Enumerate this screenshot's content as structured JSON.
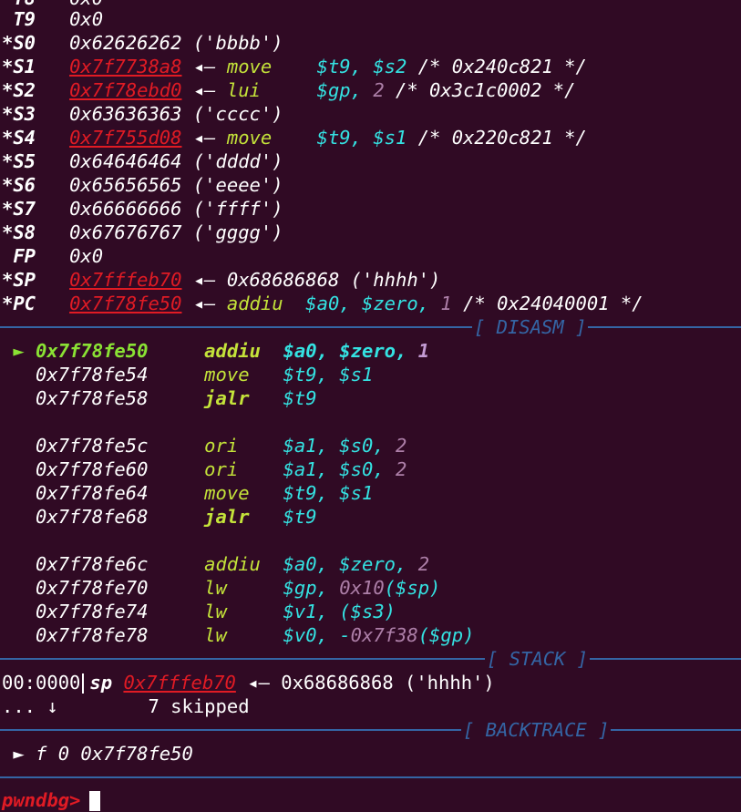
{
  "registers": [
    {
      "flag": " ",
      "name": "T9",
      "value": "0x0"
    },
    {
      "flag": "*",
      "name": "S0",
      "value": "0x62626262",
      "note": "('bbbb')"
    },
    {
      "flag": "*",
      "name": "S1",
      "addr": "0x7f7738a8",
      "arrow": "◂—",
      "mnem": "move",
      "ops": "$t9, $s2",
      "comment": "/* 0x240c821 */"
    },
    {
      "flag": "*",
      "name": "S2",
      "addr": "0x7f78ebd0",
      "arrow": "◂—",
      "mnem": "lui",
      "ops_reg": "$gp,",
      "ops_imm": "2",
      "comment": "/* 0x3c1c0002 */"
    },
    {
      "flag": "*",
      "name": "S3",
      "value": "0x63636363",
      "note": "('cccc')"
    },
    {
      "flag": "*",
      "name": "S4",
      "addr": "0x7f755d08",
      "arrow": "◂—",
      "mnem": "move",
      "ops": "$t9, $s1",
      "comment": "/* 0x220c821 */"
    },
    {
      "flag": "*",
      "name": "S5",
      "value": "0x64646464",
      "note": "('dddd')"
    },
    {
      "flag": "*",
      "name": "S6",
      "value": "0x65656565",
      "note": "('eeee')"
    },
    {
      "flag": "*",
      "name": "S7",
      "value": "0x66666666",
      "note": "('ffff')"
    },
    {
      "flag": "*",
      "name": "S8",
      "value": "0x67676767",
      "note": "('gggg')"
    },
    {
      "flag": " ",
      "name": "FP",
      "value": "0x0"
    },
    {
      "flag": "*",
      "name": "SP",
      "addr": "0x7fffeb70",
      "arrow": "◂—",
      "target": "0x68686868 ('hhhh')"
    },
    {
      "flag": "*",
      "name": "PC",
      "addr": "0x7f78fe50",
      "arrow": "◂—",
      "mnem": "addiu",
      "ops_reg": "$a0, $zero,",
      "ops_imm": "1",
      "comment": "/* 0x24040001 */"
    }
  ],
  "sections": {
    "disasm": "[ DISASM ]",
    "stack": "[ STACK ]",
    "backtrace": "[ BACKTRACE ]"
  },
  "disasm": [
    {
      "marker": "►",
      "addr": "0x7f78fe50",
      "mnem": "addiu",
      "ops": "$a0, $zero,",
      "imm": "1"
    },
    {
      "addr": "0x7f78fe54",
      "mnem": "move",
      "ops": "$t9, $s1"
    },
    {
      "addr": "0x7f78fe58",
      "mnem": "jalr",
      "ops": "$t9"
    },
    {
      "addr": "0x7f78fe5c",
      "mnem": "ori",
      "ops": "$a1, $s0,",
      "imm": "2"
    },
    {
      "addr": "0x7f78fe60",
      "mnem": "ori",
      "ops": "$a1, $s0,",
      "imm": "2"
    },
    {
      "addr": "0x7f78fe64",
      "mnem": "move",
      "ops": "$t9, $s1"
    },
    {
      "addr": "0x7f78fe68",
      "mnem": "jalr",
      "ops": "$t9"
    },
    {
      "addr": "0x7f78fe6c",
      "mnem": "addiu",
      "ops": "$a0, $zero,",
      "imm": "2"
    },
    {
      "addr": "0x7f78fe70",
      "mnem": "lw",
      "ops_a": "$gp,",
      "imm": "0x10",
      "ops_b": "($sp)"
    },
    {
      "addr": "0x7f78fe74",
      "mnem": "lw",
      "ops": "$v1, ($s3)"
    },
    {
      "addr": "0x7f78fe78",
      "mnem": "lw",
      "ops_a": "$v0, -",
      "imm": "0x7f38",
      "ops_b": "($gp)"
    }
  ],
  "stack": {
    "offset": "00:0000",
    "reg": "sp",
    "addr": "0x7fffeb70",
    "arrow": "◂—",
    "value": "0x68686868 ('hhhh')",
    "skip_prefix": "... ↓",
    "skip_text": "7 skipped"
  },
  "backtrace": {
    "marker": "►",
    "text": "f 0 0x7f78fe50"
  },
  "prompt": "pwndbg>",
  "partial_top": "0x0"
}
